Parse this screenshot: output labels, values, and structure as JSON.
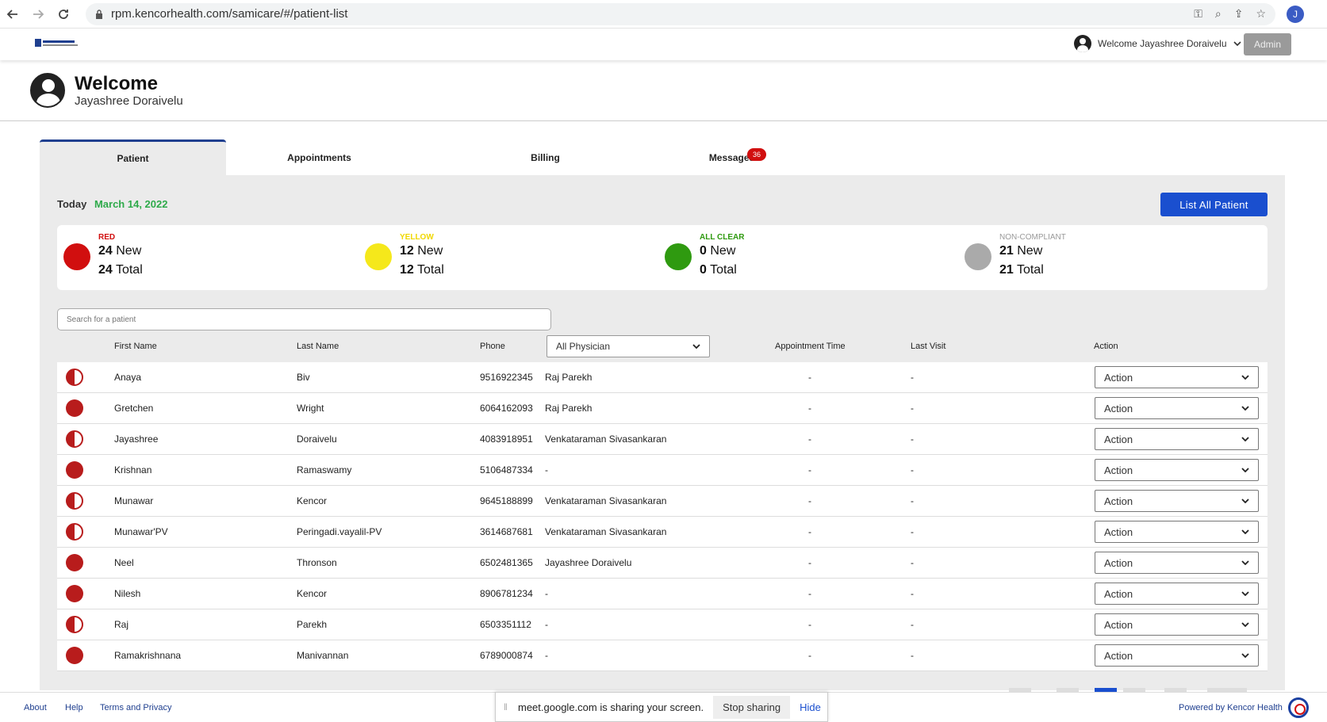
{
  "browser": {
    "url": "rpm.kencorhealth.com/samicare/#/patient-list",
    "profile_initial": "J"
  },
  "header": {
    "welcome_menu": "Welcome Jayashree Doraivelu",
    "admin_label": "Admin"
  },
  "welcome": {
    "title": "Welcome",
    "name": "Jayashree Doraivelu"
  },
  "tabs": [
    {
      "label": "Patient"
    },
    {
      "label": "Appointments"
    },
    {
      "label": "Billing"
    },
    {
      "label": "Messages"
    }
  ],
  "messages_badge": "36",
  "today": {
    "label": "Today",
    "date": "March 14, 2022"
  },
  "list_all_button": "List All Patient",
  "status_cards": [
    {
      "label": "RED",
      "new": "24",
      "new_label": "New",
      "total": "24",
      "total_label": "Total",
      "color": "#d10f0f"
    },
    {
      "label": "YELLOW",
      "new": "12",
      "new_label": "New",
      "total": "12",
      "total_label": "Total",
      "color": "#f5e81b"
    },
    {
      "label": "ALL CLEAR",
      "new": "0",
      "new_label": "New",
      "total": "0",
      "total_label": "Total",
      "color": "#2f9a10"
    },
    {
      "label": "NON-COMPLIANT",
      "new": "21",
      "new_label": "New",
      "total": "21",
      "total_label": "Total",
      "color": "#aaaaaa"
    }
  ],
  "search": {
    "placeholder": "Search for a patient"
  },
  "table": {
    "headers": {
      "first_name": "First Name",
      "last_name": "Last Name",
      "phone": "Phone",
      "physician_filter": "All Physician",
      "appointment_time": "Appointment Time",
      "last_visit": "Last Visit",
      "action": "Action"
    },
    "rows": [
      {
        "status": "half",
        "first": "Anaya",
        "last": "Biv",
        "phone": "9516922345",
        "physician": "Raj Parekh",
        "appt": "-",
        "visit": "-",
        "action": "Action"
      },
      {
        "status": "full",
        "first": "Gretchen",
        "last": "Wright",
        "phone": "6064162093",
        "physician": "Raj Parekh",
        "appt": "-",
        "visit": "-",
        "action": "Action"
      },
      {
        "status": "half",
        "first": "Jayashree",
        "last": "Doraivelu",
        "phone": "4083918951",
        "physician": "Venkataraman Sivasankaran",
        "appt": "-",
        "visit": "-",
        "action": "Action"
      },
      {
        "status": "full",
        "first": "Krishnan",
        "last": "Ramaswamy",
        "phone": "5106487334",
        "physician": "-",
        "appt": "-",
        "visit": "-",
        "action": "Action"
      },
      {
        "status": "half",
        "first": "Munawar",
        "last": "Kencor",
        "phone": "9645188899",
        "physician": "Venkataraman Sivasankaran",
        "appt": "-",
        "visit": "-",
        "action": "Action"
      },
      {
        "status": "half",
        "first": "Munawar'PV",
        "last": "Peringadi.vayalil-PV",
        "phone": "3614687681",
        "physician": "Venkataraman Sivasankaran",
        "appt": "-",
        "visit": "-",
        "action": "Action"
      },
      {
        "status": "full",
        "first": "Neel",
        "last": "Thronson",
        "phone": "6502481365",
        "physician": "Jayashree Doraivelu",
        "appt": "-",
        "visit": "-",
        "action": "Action"
      },
      {
        "status": "full",
        "first": "Nilesh",
        "last": "Kencor",
        "phone": "8906781234",
        "physician": "-",
        "appt": "-",
        "visit": "-",
        "action": "Action"
      },
      {
        "status": "half",
        "first": "Raj",
        "last": "Parekh",
        "phone": "6503351112",
        "physician": "-",
        "appt": "-",
        "visit": "-",
        "action": "Action"
      },
      {
        "status": "full",
        "first": "Ramakrishnana",
        "last": "Manivannan",
        "phone": "6789000874",
        "physician": "-",
        "appt": "-",
        "visit": "-",
        "action": "Action"
      }
    ]
  },
  "footer": {
    "about": "About",
    "help": "Help",
    "terms": "Terms and Privacy",
    "powered_by": "Powered by Kencor Health"
  },
  "share_bar": {
    "text": "meet.google.com is sharing your screen.",
    "stop": "Stop sharing",
    "hide": "Hide"
  }
}
